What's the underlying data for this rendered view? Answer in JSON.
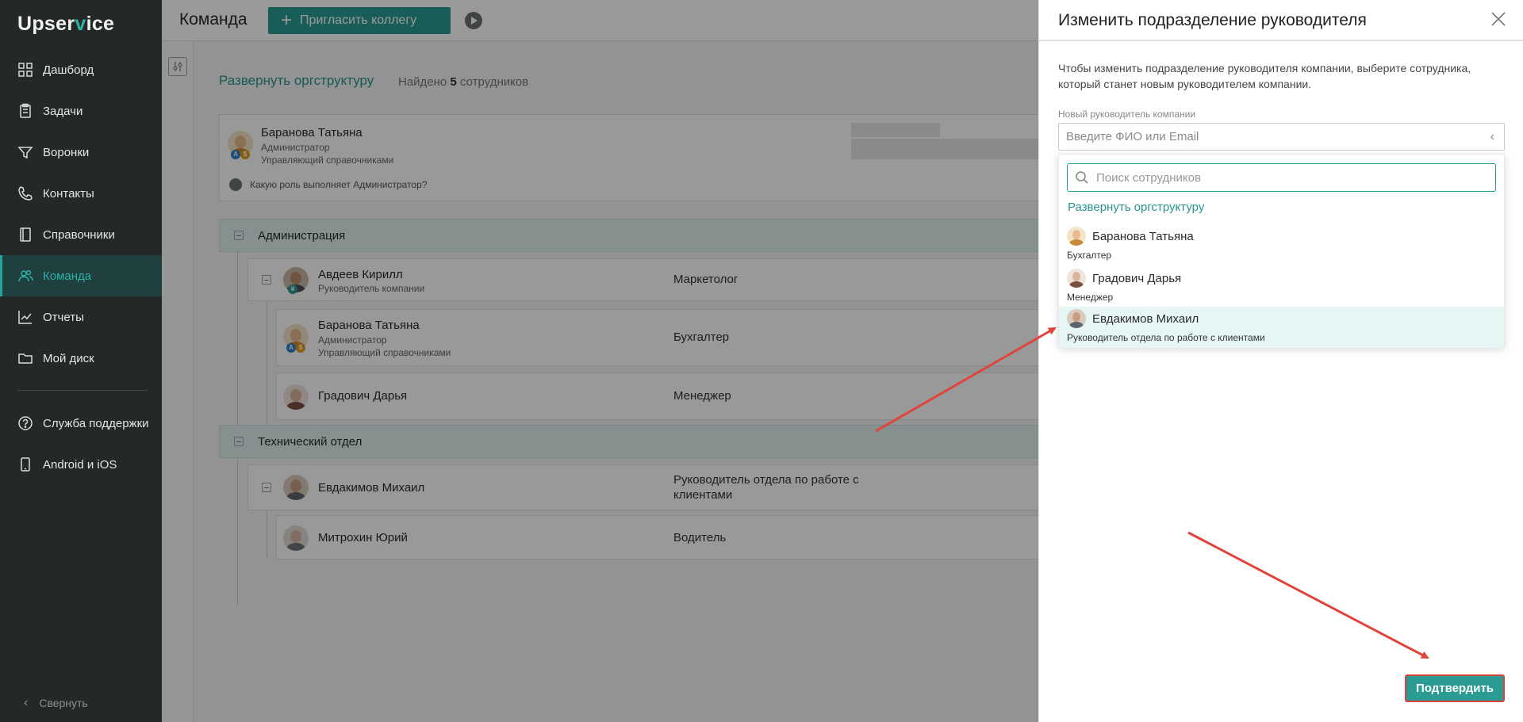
{
  "app": {
    "logo_prefix": "Upser",
    "logo_v": "v",
    "logo_suffix": "ice"
  },
  "sidebar": {
    "items": [
      {
        "label": "Дашборд",
        "icon": "dashboard-icon"
      },
      {
        "label": "Задачи",
        "icon": "tasks-icon"
      },
      {
        "label": "Воронки",
        "icon": "funnel-icon"
      },
      {
        "label": "Контакты",
        "icon": "phone-icon"
      },
      {
        "label": "Справочники",
        "icon": "book-icon"
      },
      {
        "label": "Команда",
        "icon": "team-icon",
        "active": true
      },
      {
        "label": "Отчеты",
        "icon": "chart-icon"
      },
      {
        "label": "Мой диск",
        "icon": "folder-icon"
      }
    ],
    "bottom_items": [
      {
        "label": "Служба поддержки",
        "icon": "help-icon"
      },
      {
        "label": "Android и iOS",
        "icon": "mobile-icon"
      }
    ],
    "collapse_label": "Свернуть"
  },
  "topbar": {
    "title": "Команда",
    "invite_label": "Пригласить коллегу"
  },
  "main": {
    "expand_link": "Развернуть оргструктуру",
    "found_prefix": "Найдено",
    "found_count": "5",
    "found_suffix": "сотрудников",
    "admin_card": {
      "name": "Баранова Татьяна",
      "role1": "Администратор",
      "role2": "Управляющий справочниками",
      "help_link": "Какую роль выполняет Администратор?"
    },
    "departments": [
      {
        "name": "Администрация",
        "members": [
          {
            "name": "Авдеев Кирилл",
            "sub": "Руководитель компании",
            "position": "Маркетолог"
          },
          {
            "name": "Баранова Татьяна",
            "sub1": "Администратор",
            "sub2": "Управляющий справочниками",
            "position": "Бухгалтер"
          },
          {
            "name": "Градович Дарья",
            "position": "Менеджер"
          }
        ]
      },
      {
        "name": "Технический отдел",
        "members": [
          {
            "name": "Евдакимов Михаил",
            "position_line1": "Руководитель отдела по работе с",
            "position_line2": "клиентами"
          },
          {
            "name": "Митрохин Юрий",
            "position": "Водитель"
          }
        ]
      }
    ]
  },
  "panel": {
    "title": "Изменить подразделение руководителя",
    "description": "Чтобы изменить подразделение руководителя компании, выберите сотрудника, который станет новым руководителем компании.",
    "field_label": "Новый руководитель компании",
    "field_placeholder": "Введите ФИО или Email",
    "search_placeholder": "Поиск сотрудников",
    "dropdown_expand": "Развернуть оргструктуру",
    "options": [
      {
        "name": "Баранова Татьяна",
        "role": "Бухгалтер"
      },
      {
        "name": "Градович Дарья",
        "role": "Менеджер"
      },
      {
        "name": "Евдакимов Михаил",
        "role": "Руководитель отдела по работе с клиентами",
        "highlighted": true
      }
    ],
    "confirm_label": "Подтвердить"
  },
  "colors": {
    "accent": "#2a9c93",
    "sidebar_bg": "#252828",
    "annotation_arrow": "#e0443a"
  }
}
